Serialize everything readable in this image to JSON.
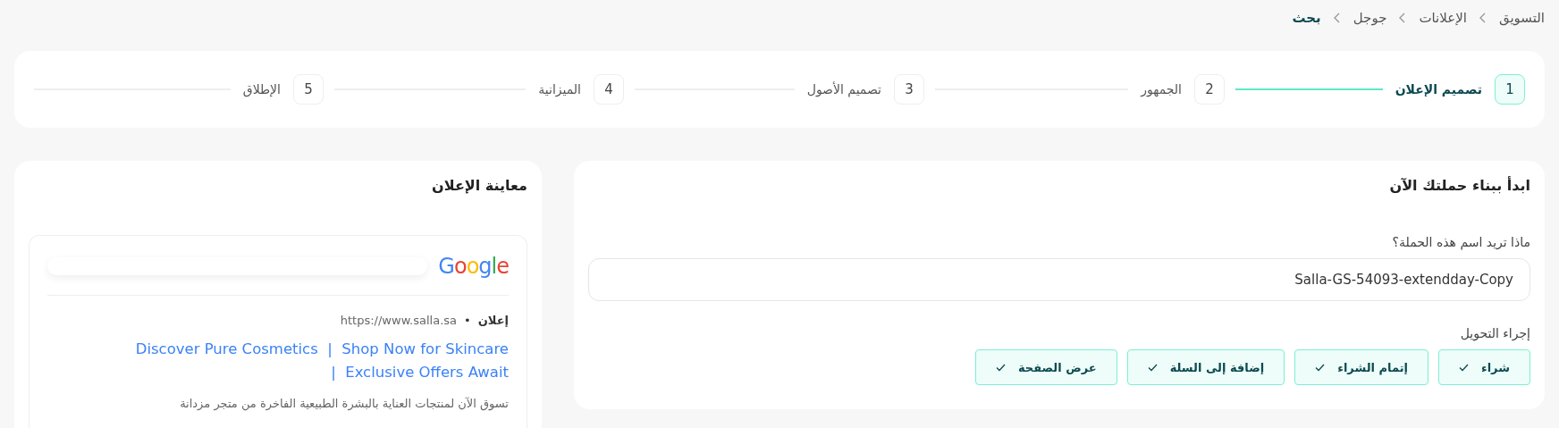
{
  "breadcrumb": [
    {
      "label": "التسويق",
      "current": false
    },
    {
      "label": "الإعلانات",
      "current": false
    },
    {
      "label": "جوجل",
      "current": false
    },
    {
      "label": "بحث",
      "current": true
    }
  ],
  "stepper": [
    {
      "number": "1",
      "label": "تصميم الإعلان",
      "selected": true
    },
    {
      "number": "2",
      "label": "الجمهور",
      "selected": false
    },
    {
      "number": "3",
      "label": "تصميم الأصول",
      "selected": false
    },
    {
      "number": "4",
      "label": "الميزانية",
      "selected": false
    },
    {
      "number": "5",
      "label": "الإطلاق",
      "selected": false
    }
  ],
  "form": {
    "title": "ابدأ ببناء حملتك الآن",
    "name_label": "ماذا تريد اسم هذه الحملة؟",
    "name_value": "Salla-GS-54093-extendday-Copy",
    "conversion_label": "إجراء التحويل",
    "conversion_actions": [
      {
        "label": "شراء",
        "selected": true
      },
      {
        "label": "إتمام الشراء",
        "selected": true
      },
      {
        "label": "إضافة إلى السلة",
        "selected": true
      },
      {
        "label": "عرض الصفحة",
        "selected": true
      }
    ]
  },
  "preview": {
    "title": "معاينة الإعلان",
    "logo": "Google",
    "ad_badge": "إعلان",
    "separator": "•",
    "url": "https://www.salla.sa",
    "headline": "Discover Pure Cosmetics  |  Shop Now for Skincare  |  Exclusive Offers Await",
    "description": "تسوق الآن لمنتجات العناية بالبشرة الطبيعية الفاخرة من متجر مزدانة"
  }
}
